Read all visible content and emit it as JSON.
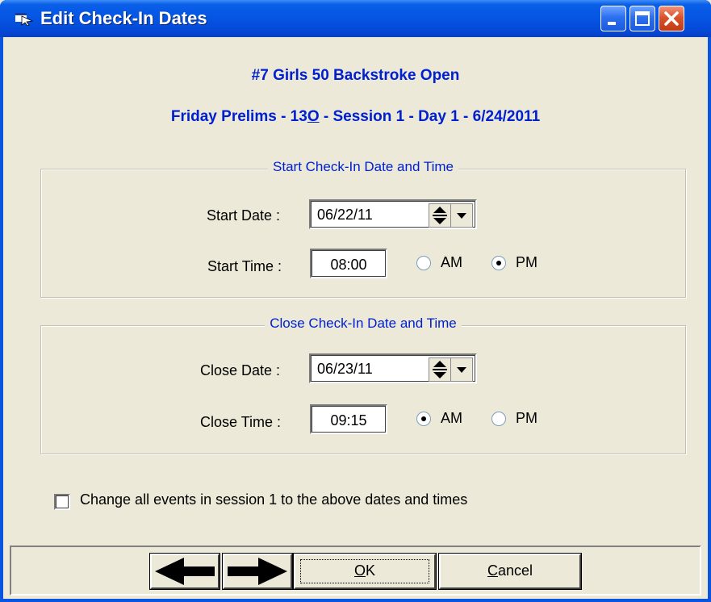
{
  "window": {
    "title": "Edit Check-In Dates"
  },
  "event": {
    "name": "#7  Girls 50 Backstroke Open",
    "session_prefix": "Friday Prelims - 13",
    "session_underlined": "O",
    "session_suffix": " - Session 1 - Day 1 - 6/24/2011"
  },
  "start_group": {
    "title": "Start Check-In Date and Time",
    "date_label": "Start Date :",
    "date_value": "06/22/11",
    "time_label": "Start Time :",
    "time_value": "08:00",
    "am_label": "AM",
    "pm_label": "PM",
    "selected": "PM"
  },
  "close_group": {
    "title": "Close Check-In Date and Time",
    "date_label": "Close Date :",
    "date_value": "06/23/11",
    "time_label": "Close Time :",
    "time_value": "09:15",
    "am_label": "AM",
    "pm_label": "PM",
    "selected": "AM"
  },
  "change_all": {
    "label": "Change all events in session 1 to the above dates and times",
    "checked": false
  },
  "buttons": {
    "ok_label": "OK",
    "ok_mnemonic": "O",
    "ok_rest": "K",
    "cancel_mnemonic": "C",
    "cancel_rest": "ancel",
    "cancel_label": "Cancel"
  },
  "colors": {
    "accent_text": "#0020d0",
    "title_bar": "#0554e3",
    "dialog_bg": "#ece9d8"
  }
}
